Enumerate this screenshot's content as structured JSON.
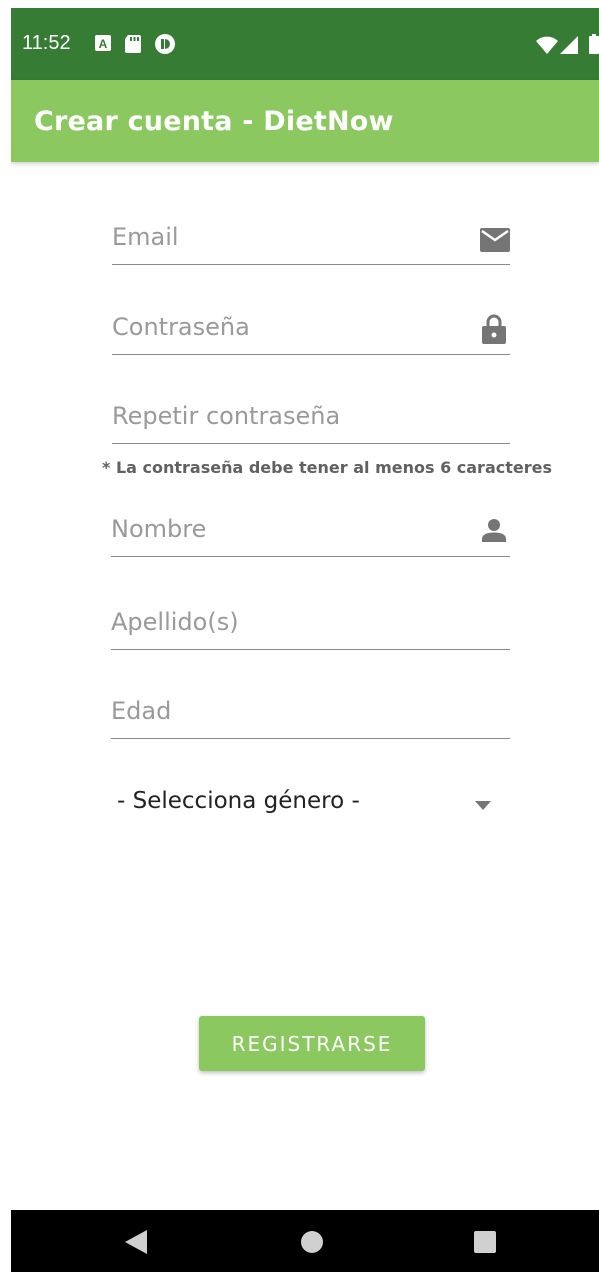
{
  "status_bar": {
    "time": "11:52",
    "icons": [
      "a-icon",
      "sd-card-icon",
      "notification-icon",
      "wifi-icon",
      "signal-icon",
      "battery-icon"
    ],
    "color": "#367c35"
  },
  "app_bar": {
    "title": "Crear cuenta - DietNow",
    "color": "#8bc860"
  },
  "form": {
    "email": {
      "placeholder": "Email",
      "value": "",
      "icon": "mail-icon"
    },
    "password": {
      "placeholder": "Contraseña",
      "value": "",
      "icon": "lock-icon"
    },
    "repeat_password": {
      "placeholder": "Repetir contraseña",
      "value": ""
    },
    "password_hint": "* La contraseña debe tener al menos 6 caracteres",
    "first_name": {
      "placeholder": "Nombre",
      "value": "",
      "icon": "person-icon"
    },
    "last_name": {
      "placeholder": "Apellido(s)",
      "value": ""
    },
    "age": {
      "placeholder": "Edad",
      "value": ""
    },
    "gender": {
      "selected": "- Selecciona género -",
      "icon": "dropdown-arrow-icon"
    },
    "register_label": "REGISTRARSE"
  },
  "nav_bar": {
    "buttons": [
      "back-icon",
      "home-icon",
      "recents-icon"
    ]
  }
}
